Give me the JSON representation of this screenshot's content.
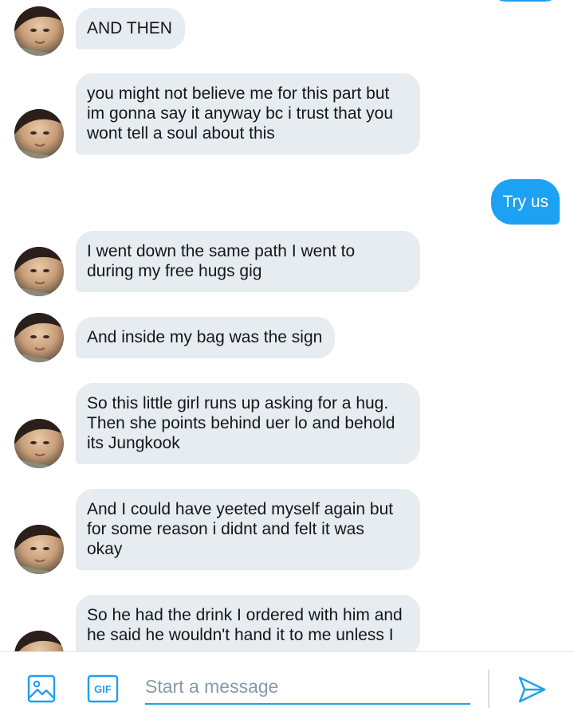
{
  "colors": {
    "accent": "#1da1f2",
    "incoming_bubble": "#e6ecf0",
    "incoming_text": "#14171a",
    "outgoing_text": "#ffffff",
    "placeholder": "#8899a6"
  },
  "messages": [
    {
      "direction": "incoming",
      "text": "AND THEN"
    },
    {
      "direction": "incoming",
      "text": "you might not believe me for this part but\nim gonna say it anyway bc i trust that you\nwont tell a soul about this"
    },
    {
      "direction": "outgoing",
      "text": "Try us"
    },
    {
      "direction": "incoming",
      "text": "I went down the same path I went to\nduring my free hugs gig"
    },
    {
      "direction": "incoming",
      "text": "And inside my bag was the sign"
    },
    {
      "direction": "incoming",
      "text": "So this little girl runs up asking for a hug.\nThen she points behind uer lo and behold\nits Jungkook"
    },
    {
      "direction": "incoming",
      "text": "And I could have yeeted myself again but\nfor some reason i didnt and felt it was\nokay"
    },
    {
      "direction": "incoming",
      "text": "So he had the drink I ordered with him and\nhe said he wouldn't hand it to me unless I"
    }
  ],
  "composer": {
    "placeholder": "Start a message",
    "value": "",
    "media_icon": "image-icon",
    "gif_icon": "gif-icon",
    "gif_label": "GIF",
    "send_icon": "send-icon"
  }
}
